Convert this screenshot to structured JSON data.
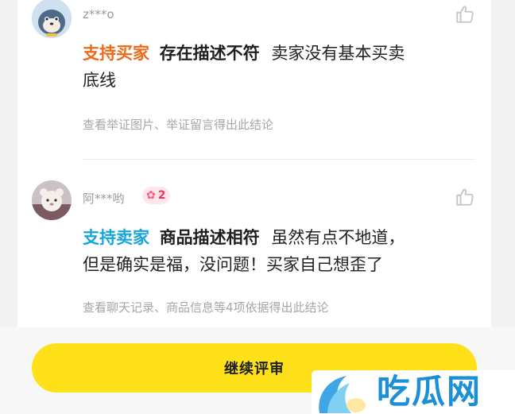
{
  "comments": [
    {
      "username": "z***o",
      "side_label": "支持买家",
      "verdict": "存在描述不符",
      "reason_lines": [
        "卖家没有基本买卖",
        "底线"
      ],
      "evidence_note": "查看举证图片、举证留言得出此结论",
      "avatar_icon": "seal-avatar-icon",
      "like_icon": "thumbs-up-icon"
    },
    {
      "username": "阿***哟",
      "badge_icon": "flower-icon",
      "badge_count": "2",
      "side_label": "支持卖家",
      "verdict": "商品描述相符",
      "reason_lines": [
        "虽然有点不地道，",
        "但是确实是福，没问题！买家自己想歪了"
      ],
      "evidence_note": "查看聊天记录、商品信息等4项依据得出此结论",
      "avatar_icon": "bear-avatar-icon",
      "like_icon": "thumbs-up-icon"
    }
  ],
  "continue_button_label": "继续评审",
  "watermark_text": "吃瓜网",
  "colors": {
    "buyer_accent": "#ee6a1a",
    "seller_accent": "#17a6dc",
    "button_yellow": "#ffe11a",
    "badge_pink": "#e8385e",
    "watermark_blue": "#1b8fd8"
  }
}
